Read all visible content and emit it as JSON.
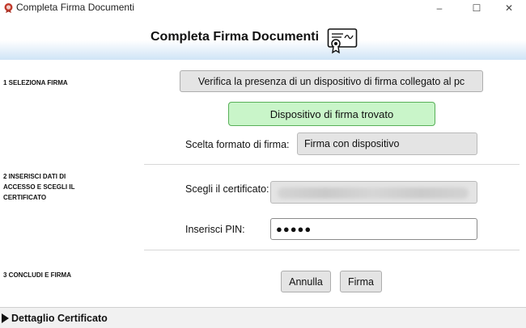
{
  "window": {
    "title": "Completa Firma Documenti",
    "icon": "app-seal-icon",
    "controls": {
      "minimize": "–",
      "maximize": "☐",
      "close": "✕"
    }
  },
  "header": {
    "title": "Completa Firma Documenti",
    "icon": "certificate-icon"
  },
  "sections": {
    "s1": "1 SELEZIONA FIRMA",
    "s2": "2 INSERISCI DATI DI ACCESSO E SCEGLI IL CERTIFICATO",
    "s3": "3 CONCLUDI E FIRMA"
  },
  "step1": {
    "verify_button": "Verifica la presenza di un dispositivo di firma collegato al pc",
    "status": "Dispositivo di firma trovato",
    "format_label": "Scelta formato di firma:",
    "format_value": "Firma con dispositivo"
  },
  "step2": {
    "cert_label": "Scegli il certificato:",
    "pin_label": "Inserisci PIN:",
    "pin_value": "●●●●●"
  },
  "step3": {
    "cancel_button": "Annulla",
    "sign_button": "Firma"
  },
  "footer": {
    "label": "Dettaglio Certificato"
  },
  "colors": {
    "status_bg": "#c9f5c9",
    "status_border": "#58b058",
    "header_gradient_end": "#cfe4f6"
  }
}
